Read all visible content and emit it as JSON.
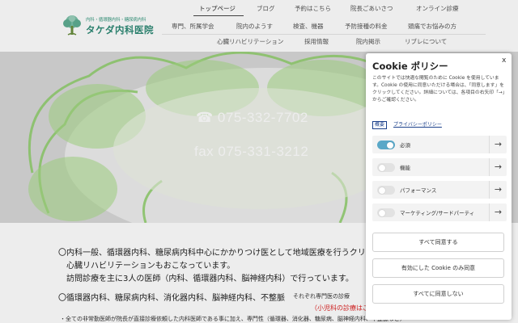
{
  "header": {
    "logo_sub": "内科・循環器内科・糖尿病内科",
    "logo_main": "タケダ内科医院",
    "nav_row1": [
      "トップページ",
      "ブログ",
      "予約はこちら",
      "院長ごあいさつ",
      "オンライン診療"
    ],
    "nav_row2": [
      "専門、所属学会",
      "院内のようす",
      "検査、機器",
      "予防接種の料金",
      "頭痛でお悩みの方"
    ],
    "nav_row3": [
      "心臓リハビリテーション",
      "採用情報",
      "院内掲示",
      "リブレについて"
    ]
  },
  "hero": {
    "phone_icon": "☎",
    "phone": "075-332-7702",
    "fax": "fax 075-331-3212"
  },
  "content": {
    "line1": "〇内科一般、循環器内科、糖尿病内科中心にかかりつけ医として地域医療を行うクリ",
    "line2": "心臓リハビリテーションもおこなっています。",
    "line3": "訪問診療を主に3人の医師（内科、循環器内科、脳神経内科）で行っています。",
    "line4": "〇循環器内科、糖尿病内科、消化器内科、脳神経内科、不整脈",
    "line4b": "それぞれ専門医の診療",
    "line5": "（小児科の診療はご",
    "line6": "・全ての非常勤医師が院長が直接診療依頼した内科医師である事に加え、専門性（循環器、消化器、糖尿病、脳神経内科、不整脈など）"
  },
  "cookie": {
    "title": "Cookie ポリシー",
    "close": "x",
    "description": "このサイトでは快適な閲覧のために Cookie を使用しています。Cookie の使用に同意いただける場合は、「同意します」をクリックしてください。詳細については、各項目の右矢印「→」からご確認ください。",
    "link_summary": "概要",
    "link_privacy": "プライバシーポリシー",
    "categories": [
      {
        "label": "必須",
        "on": true
      },
      {
        "label": "機能",
        "on": false
      },
      {
        "label": "パフォーマンス",
        "on": false
      },
      {
        "label": "マーケティング/サードパーティ",
        "on": false
      }
    ],
    "arrow": "→",
    "btn_accept_all": "すべて同意する",
    "btn_accept_enabled": "有効にした Cookie のみ同意",
    "btn_reject_all": "すべてに同意しない"
  },
  "colors": {
    "accent": "#5aa8c8",
    "brand": "#2f8a76",
    "link": "#1a3f8a",
    "notice": "#dd2222"
  }
}
